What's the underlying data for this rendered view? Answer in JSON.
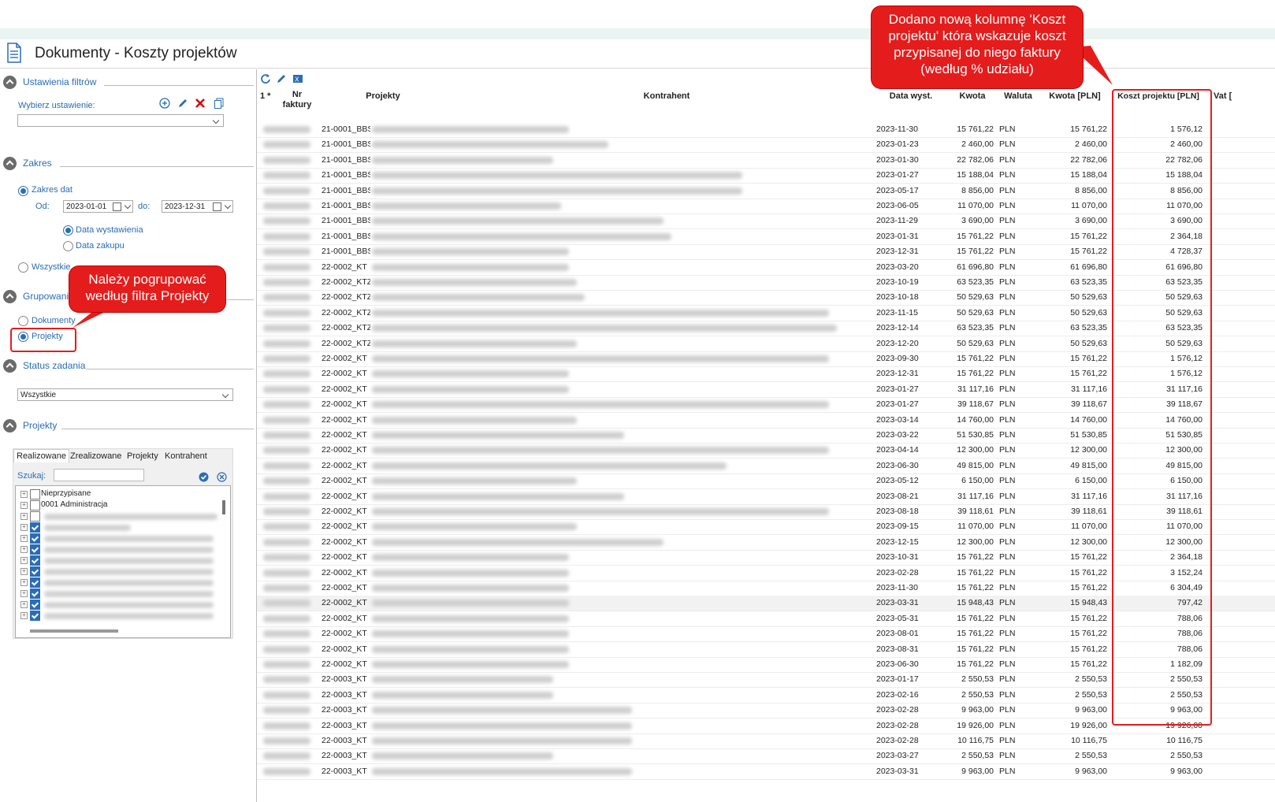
{
  "window": {
    "title": "Dokumenty - Koszty projektów"
  },
  "left": {
    "filters_section": "Ustawienia filtrów",
    "choose_setting_label": "Wybierz ustawienie:",
    "range_section": "Zakres",
    "range_dates_label": "Zakres dat",
    "from_label": "Od:",
    "from_value": "2023-01-01",
    "to_label": "do:",
    "to_value": "2023-12-31",
    "date_issue_label": "Data wystawienia",
    "date_purchase_label": "Data zakupu",
    "all_label": "Wszystkie",
    "grouping_section": "Grupowanie",
    "group_documents": "Dokumenty",
    "group_projects": "Projekty",
    "status_section": "Status zadania",
    "status_value": "Wszystkie",
    "projects_section": "Projekty",
    "tabs": [
      "Realizowane",
      "Zrealizowane",
      "Projekty",
      "Kontrahent"
    ],
    "search_label": "Szukaj:",
    "tree_items": [
      "Nieprzypisane",
      "0001 Administracja"
    ]
  },
  "grid": {
    "headers": {
      "sel": "1 *",
      "nr": "Nr faktury",
      "projekty": "Projekty",
      "kontrahent": "Kontrahent",
      "data": "Data wyst.",
      "kwota": "Kwota",
      "waluta": "Waluta",
      "kwota_pln": "Kwota [PLN]",
      "koszt": "Koszt projektu [PLN]",
      "vat": "Vat ["
    },
    "rows": [
      [
        "21-0001_BBS",
        "2023-11-30",
        "15 761,22",
        "PLN",
        "15 761,22",
        "1 576,12"
      ],
      [
        "21-0001_BBS",
        "2023-01-23",
        "2 460,00",
        "PLN",
        "2 460,00",
        "2 460,00"
      ],
      [
        "21-0001_BBS",
        "2023-01-30",
        "22 782,06",
        "PLN",
        "22 782,06",
        "22 782,06"
      ],
      [
        "21-0001_BBS",
        "2023-01-27",
        "15 188,04",
        "PLN",
        "15 188,04",
        "15 188,04"
      ],
      [
        "21-0001_BBS",
        "2023-05-17",
        "8 856,00",
        "PLN",
        "8 856,00",
        "8 856,00"
      ],
      [
        "21-0001_BBS",
        "2023-06-05",
        "11 070,00",
        "PLN",
        "11 070,00",
        "11 070,00"
      ],
      [
        "21-0001_BBS",
        "2023-11-29",
        "3 690,00",
        "PLN",
        "3 690,00",
        "3 690,00"
      ],
      [
        "21-0001_BBS",
        "2023-01-31",
        "15 761,22",
        "PLN",
        "15 761,22",
        "2 364,18"
      ],
      [
        "21-0001_BBS",
        "2023-12-31",
        "15 761,22",
        "PLN",
        "15 761,22",
        "4 728,37"
      ],
      [
        "22-0002_KT",
        "2023-03-20",
        "61 696,80",
        "PLN",
        "61 696,80",
        "61 696,80"
      ],
      [
        "22-0002_KTZ",
        "2023-10-19",
        "63 523,35",
        "PLN",
        "63 523,35",
        "63 523,35"
      ],
      [
        "22-0002_KTZ",
        "2023-10-18",
        "50 529,63",
        "PLN",
        "50 529,63",
        "50 529,63"
      ],
      [
        "22-0002_KTZ",
        "2023-11-15",
        "50 529,63",
        "PLN",
        "50 529,63",
        "50 529,63"
      ],
      [
        "22-0002_KTZ",
        "2023-12-14",
        "63 523,35",
        "PLN",
        "63 523,35",
        "63 523,35"
      ],
      [
        "22-0002_KTZ",
        "2023-12-20",
        "50 529,63",
        "PLN",
        "50 529,63",
        "50 529,63"
      ],
      [
        "22-0002_KT",
        "2023-09-30",
        "15 761,22",
        "PLN",
        "15 761,22",
        "1 576,12"
      ],
      [
        "22-0002_KT",
        "2023-12-31",
        "15 761,22",
        "PLN",
        "15 761,22",
        "1 576,12"
      ],
      [
        "22-0002_KT",
        "2023-01-27",
        "31 117,16",
        "PLN",
        "31 117,16",
        "31 117,16"
      ],
      [
        "22-0002_KT",
        "2023-01-27",
        "39 118,67",
        "PLN",
        "39 118,67",
        "39 118,67"
      ],
      [
        "22-0002_KT",
        "2023-03-14",
        "14 760,00",
        "PLN",
        "14 760,00",
        "14 760,00"
      ],
      [
        "22-0002_KT",
        "2023-03-22",
        "51 530,85",
        "PLN",
        "51 530,85",
        "51 530,85"
      ],
      [
        "22-0002_KT",
        "2023-04-14",
        "12 300,00",
        "PLN",
        "12 300,00",
        "12 300,00"
      ],
      [
        "22-0002_KT",
        "2023-06-30",
        "49 815,00",
        "PLN",
        "49 815,00",
        "49 815,00"
      ],
      [
        "22-0002_KT",
        "2023-05-12",
        "6 150,00",
        "PLN",
        "6 150,00",
        "6 150,00"
      ],
      [
        "22-0002_KT",
        "2023-08-21",
        "31 117,16",
        "PLN",
        "31 117,16",
        "31 117,16"
      ],
      [
        "22-0002_KT",
        "2023-08-18",
        "39 118,61",
        "PLN",
        "39 118,61",
        "39 118,61"
      ],
      [
        "22-0002_KT",
        "2023-09-15",
        "11 070,00",
        "PLN",
        "11 070,00",
        "11 070,00"
      ],
      [
        "22-0002_KT",
        "2023-12-15",
        "12 300,00",
        "PLN",
        "12 300,00",
        "12 300,00"
      ],
      [
        "22-0002_KT",
        "2023-10-31",
        "15 761,22",
        "PLN",
        "15 761,22",
        "2 364,18"
      ],
      [
        "22-0002_KT",
        "2023-02-28",
        "15 761,22",
        "PLN",
        "15 761,22",
        "3 152,24"
      ],
      [
        "22-0002_KT",
        "2023-11-30",
        "15 761,22",
        "PLN",
        "15 761,22",
        "6 304,49"
      ],
      [
        "22-0002_KT",
        "2023-03-31",
        "15 948,43",
        "PLN",
        "15 948,43",
        "797,42"
      ],
      [
        "22-0002_KT",
        "2023-05-31",
        "15 761,22",
        "PLN",
        "15 761,22",
        "788,06"
      ],
      [
        "22-0002_KT",
        "2023-08-01",
        "15 761,22",
        "PLN",
        "15 761,22",
        "788,06"
      ],
      [
        "22-0002_KT",
        "2023-08-31",
        "15 761,22",
        "PLN",
        "15 761,22",
        "788,06"
      ],
      [
        "22-0002_KT",
        "2023-06-30",
        "15 761,22",
        "PLN",
        "15 761,22",
        "1 182,09"
      ],
      [
        "22-0003_KT",
        "2023-01-17",
        "2 550,53",
        "PLN",
        "2 550,53",
        "2 550,53"
      ],
      [
        "22-0003_KT",
        "2023-02-16",
        "2 550,53",
        "PLN",
        "2 550,53",
        "2 550,53"
      ],
      [
        "22-0003_KT",
        "2023-02-28",
        "9 963,00",
        "PLN",
        "9 963,00",
        "9 963,00"
      ],
      [
        "22-0003_KT",
        "2023-02-28",
        "19 926,00",
        "PLN",
        "19 926,00",
        "19 926,00"
      ],
      [
        "22-0003_KT",
        "2023-02-28",
        "10 116,75",
        "PLN",
        "10 116,75",
        "10 116,75"
      ],
      [
        "22-0003_KT",
        "2023-03-27",
        "2 550,53",
        "PLN",
        "2 550,53",
        "2 550,53"
      ],
      [
        "22-0003_KT",
        "2023-03-31",
        "9 963,00",
        "PLN",
        "9 963,00",
        "9 963,00"
      ]
    ]
  },
  "callouts": {
    "top": "Dodano nową kolumnę 'Koszt projektu' która wskazuje koszt przypisanej do niego faktury (według % udziału)",
    "left": "Należy pogrupować według filtra Projekty"
  },
  "colors": {
    "accent": "#2a6db5",
    "callout": "#e51c1c"
  }
}
